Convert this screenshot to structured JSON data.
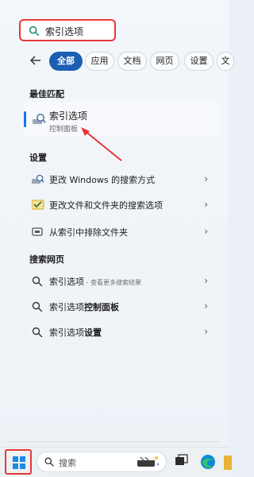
{
  "search": {
    "query": "索引选项"
  },
  "filters": {
    "items": [
      {
        "label": "全部",
        "active": true
      },
      {
        "label": "应用",
        "active": false
      },
      {
        "label": "文档",
        "active": false
      },
      {
        "label": "网页",
        "active": false
      },
      {
        "label": "设置",
        "active": false
      },
      {
        "label": "文",
        "active": false
      }
    ],
    "more": "..."
  },
  "best_match": {
    "heading": "最佳匹配",
    "title": "索引选项",
    "subtitle": "控制面板"
  },
  "settings": {
    "heading": "设置",
    "items": [
      {
        "label": "更改 Windows 的搜索方式"
      },
      {
        "label": "更改文件和文件夹的搜索选项"
      },
      {
        "label": "从索引中排除文件夹"
      }
    ]
  },
  "web": {
    "heading": "搜索网页",
    "items": [
      {
        "label": "索引选项",
        "suffix": " - 查看更多搜索结果",
        "bold_part": ""
      },
      {
        "label": "索引选项",
        "suffix": "",
        "bold_part": "控制面板"
      },
      {
        "label": "索引选项",
        "suffix": "",
        "bold_part": "设置"
      }
    ]
  },
  "taskbar": {
    "search_placeholder": "搜索"
  },
  "colors": {
    "accent": "#1a5fb4",
    "highlight_red": "#e53935"
  }
}
